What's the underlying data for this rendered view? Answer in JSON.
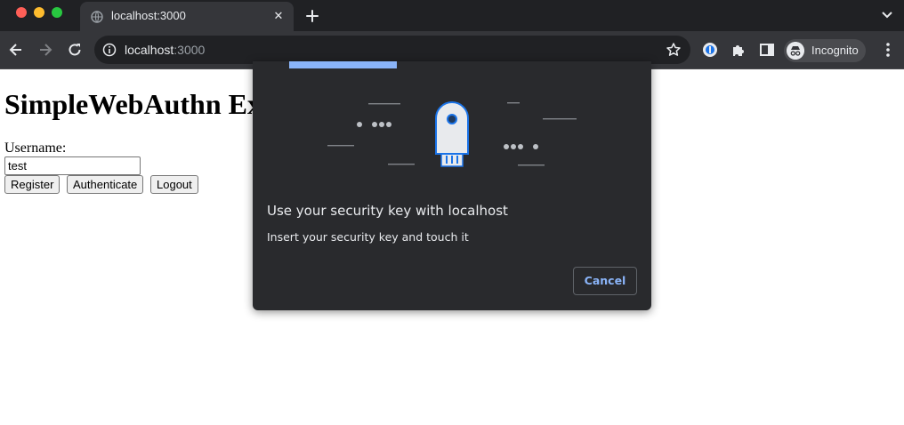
{
  "browser": {
    "tab": {
      "title": "localhost:3000"
    },
    "address": {
      "host": "localhost",
      "port": ":3000"
    },
    "profile_label": "Incognito"
  },
  "page": {
    "heading": "SimpleWebAuthn Ex",
    "username_label": "Username:",
    "username_value": "test",
    "buttons": {
      "register": "Register",
      "authenticate": "Authenticate",
      "logout": "Logout"
    }
  },
  "dialog": {
    "title": "Use your security key with localhost",
    "body": "Insert your security key and touch it",
    "cancel_label": "Cancel",
    "progress_fraction": 0.27
  },
  "colors": {
    "accent": "#8ab4f8",
    "chrome_dark": "#202124",
    "toolbar": "#35363a",
    "dialog_bg": "#292a2d"
  }
}
